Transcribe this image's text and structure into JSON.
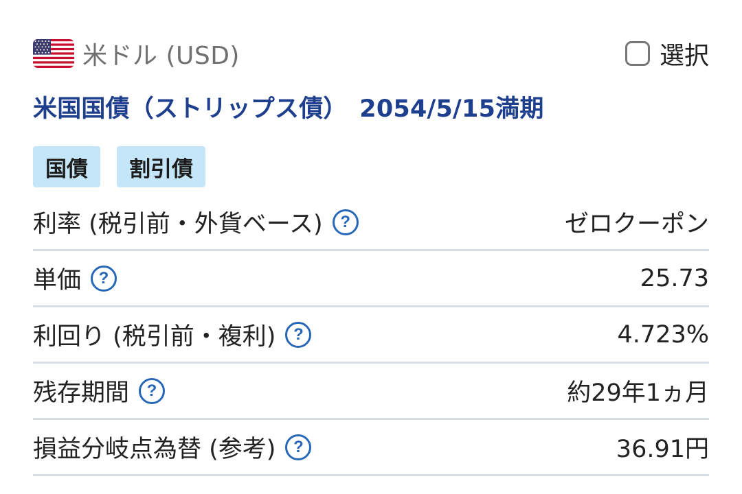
{
  "header": {
    "currency_label": "米ドル (USD)",
    "flag_icon": "us-flag-icon",
    "select_label": "選択",
    "select_checked": false
  },
  "bond": {
    "title": "米国国債（ストリップス債）　2054/5/15満期",
    "tags": [
      "国債",
      "割引債"
    ]
  },
  "details": [
    {
      "label": "利率 (税引前・外貨ベース)",
      "value": "ゼロクーポン"
    },
    {
      "label": "単価",
      "value": "25.73"
    },
    {
      "label": "利回り (税引前・複利)",
      "value": "4.723%"
    },
    {
      "label": "残存期間",
      "value": "約29年1ヵ月"
    },
    {
      "label": "損益分岐点為替 (参考)",
      "value": "36.91円"
    }
  ],
  "help_icon": "question-circle-icon",
  "help_glyph": "?",
  "colors": {
    "title": "#1d3f8d",
    "tag_bg": "#c5e6f8",
    "help": "#2767b8",
    "divider": "#d9dde5"
  }
}
